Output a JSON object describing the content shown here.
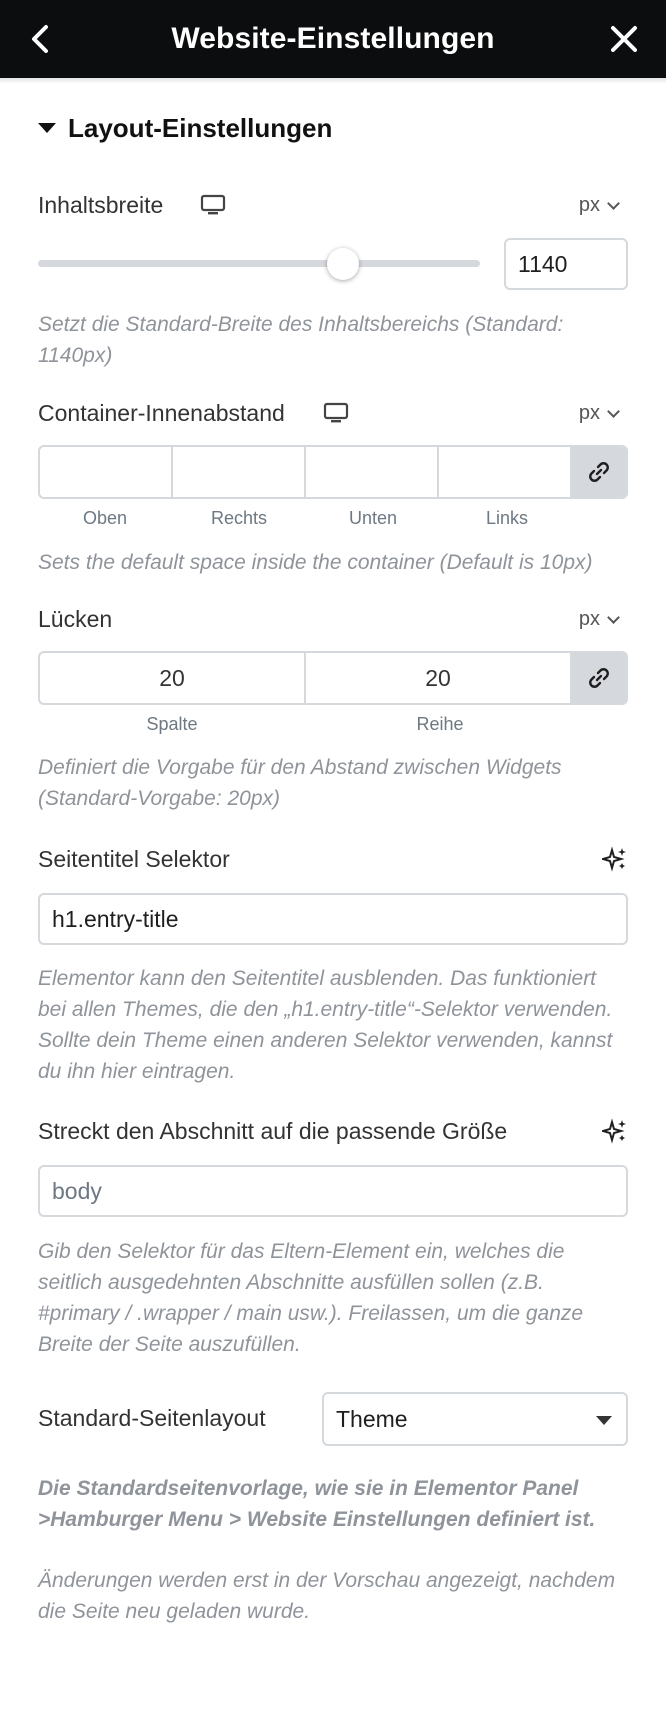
{
  "header": {
    "title": "Website-Einstellungen",
    "back_icon": "chevron-left-icon",
    "close_icon": "close-icon"
  },
  "section": {
    "title": "Layout-Einstellungen",
    "expanded": true
  },
  "content_width": {
    "label": "Inhaltsbreite",
    "device_icon": "desktop-icon",
    "unit": "px",
    "value": "1140",
    "slider_fraction": 0.69,
    "help": "Setzt die Standard-Breite des Inhaltsbereichs (Standard: 1140px)"
  },
  "container_padding": {
    "label": "Container-Innenabstand",
    "device_icon": "desktop-icon",
    "unit": "px",
    "values": [
      "",
      "",
      "",
      ""
    ],
    "sides": [
      "Oben",
      "Rechts",
      "Unten",
      "Links"
    ],
    "linked": true,
    "help": "Sets the default space inside the container (Default is 10px)"
  },
  "gaps": {
    "label": "Lücken",
    "unit": "px",
    "column": "20",
    "row": "20",
    "column_label": "Spalte",
    "row_label": "Reihe",
    "linked": true,
    "help": "Definiert die Vorgabe für den Abstand zwischen Widgets (Standard-Vorgabe: 20px)"
  },
  "page_title_selector": {
    "label": "Seitentitel Selektor",
    "value": "h1.entry-title",
    "help": "Elementor kann den Seitentitel ausblenden. Das funktioniert bei allen Themes, die den „h1.entry-title“-Selektor verwenden. Sollte dein Theme einen anderen Selektor verwenden, kannst du ihn hier eintragen."
  },
  "stretch_section": {
    "label": "Streckt den Abschnitt auf die passende Größe",
    "placeholder": "body",
    "help": "Gib den Selektor für das Eltern-Element ein, welches die seitlich ausgedehnten Abschnitte ausfüllen sollen (z.B. #primary / .wrapper / main usw.). Freilassen, um die ganze Breite der Seite auszufüllen."
  },
  "default_layout": {
    "label": "Standard-Seitenlayout",
    "selected": "Theme",
    "help_bold": "Die Standardseitenvorlage, wie sie in Elementor Panel >Hamburger Menu > Website Einstellungen definiert ist.",
    "help": "Änderungen werden erst in der Vorschau angezeigt, nachdem die Seite neu geladen wurde."
  },
  "colors": {
    "header_bg": "#0c0d0e",
    "border": "#d5d8dc",
    "help_text": "#8f949a"
  }
}
